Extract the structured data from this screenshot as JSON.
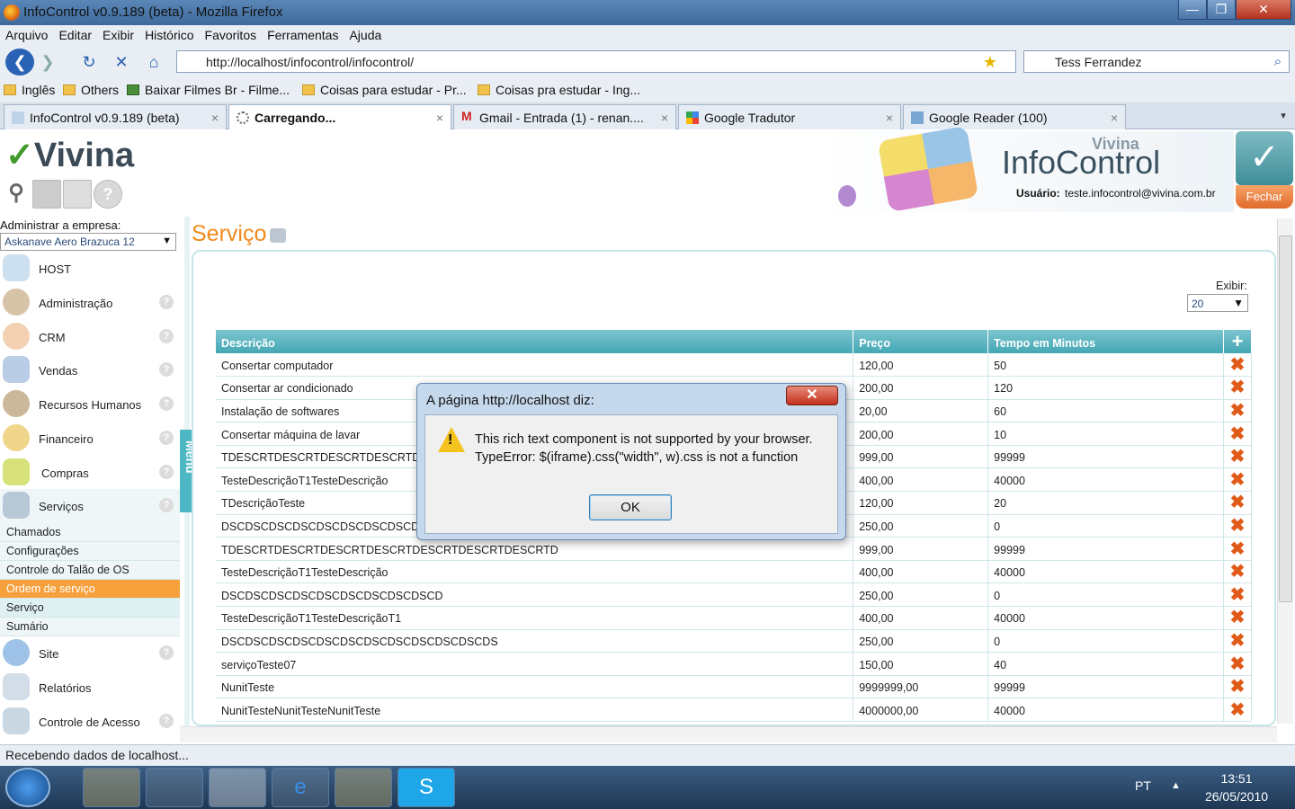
{
  "window": {
    "title": "InfoControl v0.9.189 (beta) - Mozilla Firefox",
    "min": "—",
    "max": "❐",
    "close": "✕"
  },
  "menu": [
    "Arquivo",
    "Editar",
    "Exibir",
    "Histórico",
    "Favoritos",
    "Ferramentas",
    "Ajuda"
  ],
  "nav": {
    "url": "http://localhost/infocontrol/infocontrol/",
    "search_value": "Tess Ferrandez"
  },
  "bookmarks": [
    "Inglês",
    "Others",
    "Baixar Filmes Br - Filme...",
    "Coisas para estudar - Pr...",
    "Coisas pra estudar - Ing..."
  ],
  "tabs": [
    {
      "label": "InfoControl v0.9.189 (beta)",
      "close": "×"
    },
    {
      "label": "Carregando...",
      "close": "×"
    },
    {
      "label": "Gmail - Entrada (1) - renan....",
      "close": "×"
    },
    {
      "label": "Google Tradutor",
      "close": "×"
    },
    {
      "label": "Google Reader (100)",
      "close": "×"
    }
  ],
  "app": {
    "logo": "Vivina",
    "brand_small": "Vivina",
    "brand": "InfoControl",
    "user_label": "Usuário:",
    "user_value": "teste.infocontrol@vivina.com.br",
    "logout": "Fechar",
    "admin_label": "Administrar a empresa:",
    "company": "Askanave Aero Brazuca 12",
    "menu_tab": "Menu",
    "page_title": "Serviço",
    "exibir_label": "Exibir:",
    "exibir_value": "20"
  },
  "sidebar": {
    "items": [
      {
        "label": "HOST"
      },
      {
        "label": "Administração"
      },
      {
        "label": "CRM"
      },
      {
        "label": "Vendas"
      },
      {
        "label": "Recursos Humanos"
      },
      {
        "label": "Financeiro"
      },
      {
        "label": "Compras"
      },
      {
        "label": "Serviços"
      },
      {
        "label": "Site"
      },
      {
        "label": "Relatórios"
      },
      {
        "label": "Controle de Acesso"
      }
    ],
    "subitems": [
      "Chamados",
      "Configurações",
      "Controle do Talão de OS",
      "Ordem de serviço",
      "Serviço",
      "Sumário"
    ]
  },
  "table": {
    "headers": [
      "Descrição",
      "Preço",
      "Tempo em Minutos"
    ],
    "rows": [
      [
        "Consertar computador",
        "120,00",
        "50"
      ],
      [
        "Consertar ar condicionado",
        "200,00",
        "120"
      ],
      [
        "Instalação de softwares",
        "20,00",
        "60"
      ],
      [
        "Consertar máquina de lavar",
        "200,00",
        "10"
      ],
      [
        "TDESCRTDESCRTDESCRTDESCRTDESCRTDESCRTDESCRTD",
        "999,00",
        "99999"
      ],
      [
        "TesteDescriçãoT1TesteDescrição",
        "400,00",
        "40000"
      ],
      [
        "TDescriçãoTeste",
        "120,00",
        "20"
      ],
      [
        "DSCDSCDSCDSCDSCDSCDSCDSCDSCD",
        "250,00",
        "0"
      ],
      [
        "TDESCRTDESCRTDESCRTDESCRTDESCRTDESCRTDESCRTD",
        "999,00",
        "99999"
      ],
      [
        "TesteDescriçãoT1TesteDescrição",
        "400,00",
        "40000"
      ],
      [
        "DSCDSCDSCDSCDSCDSCDSCDSCDSCD",
        "250,00",
        "0"
      ],
      [
        "TesteDescriçãoT1TesteDescriçãoT1",
        "400,00",
        "40000"
      ],
      [
        "DSCDSCDSCDSCDSCDSCDSCDSCDSCDSCDSCDS",
        "250,00",
        "0"
      ],
      [
        "serviçoTeste07",
        "150,00",
        "40"
      ],
      [
        "NunitTeste",
        "9999999,00",
        "99999"
      ],
      [
        "NunitTesteNunitTesteNunitTeste",
        "4000000,00",
        "40000"
      ]
    ]
  },
  "dialog": {
    "title": "A página http://localhost diz:",
    "line1": "This rich text component is not supported by your browser.",
    "line2": "TypeError: $(iframe).css(\"width\", w).css is not a function",
    "ok": "OK",
    "close": "✕"
  },
  "status": "Recebendo dados de localhost...",
  "taskbar": {
    "lang": "PT",
    "time": "13:51",
    "date": "26/05/2010"
  },
  "colors": {
    "accent": "#f08a1c",
    "table_header": "#44a7b5",
    "delete": "#e05a18"
  }
}
